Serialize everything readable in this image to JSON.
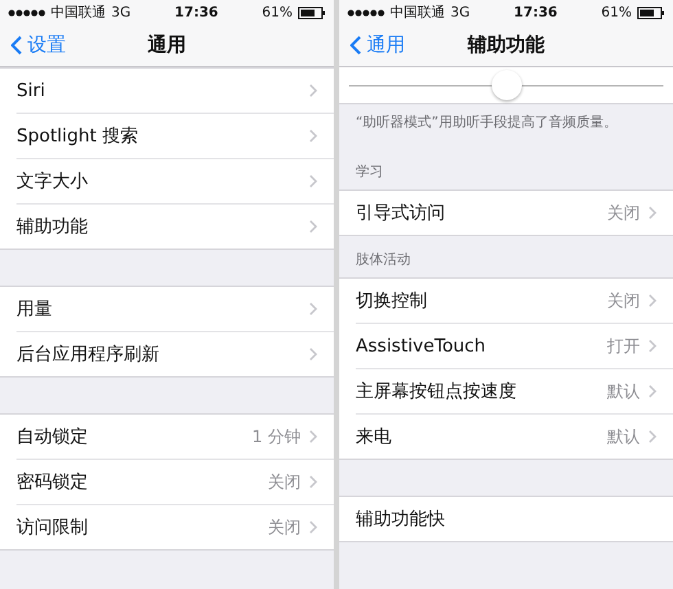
{
  "screens": [
    {
      "status_bar": {
        "carrier": "中国联通",
        "network": "3G",
        "time": "17:36",
        "battery": "61%"
      },
      "nav": {
        "back": "设置",
        "title": "通用"
      },
      "sections": [
        {
          "kind": "group",
          "rows": [
            {
              "label": "Siri",
              "chevron": true
            },
            {
              "label": "Spotlight 搜索",
              "chevron": true
            },
            {
              "label": "文字大小",
              "chevron": true
            },
            {
              "label": "辅助功能",
              "chevron": true
            }
          ]
        },
        {
          "kind": "group",
          "rows": [
            {
              "label": "用量",
              "chevron": true
            },
            {
              "label": "后台应用程序刷新",
              "chevron": true
            }
          ]
        },
        {
          "kind": "group",
          "rows": [
            {
              "label": "自动锁定",
              "value": "1 分钟",
              "chevron": true
            },
            {
              "label": "密码锁定",
              "value": "关闭",
              "chevron": true
            },
            {
              "label": "访问限制",
              "value": "关闭",
              "chevron": true
            }
          ]
        }
      ]
    },
    {
      "status_bar": {
        "carrier": "中国联通",
        "network": "3G",
        "time": "17:36",
        "battery": "61%"
      },
      "nav": {
        "back": "通用",
        "title": "辅助功能"
      },
      "sections": [
        {
          "kind": "slider",
          "level": 0.5
        },
        {
          "kind": "footer",
          "text": "“助听器模式”用助听手段提高了音频质量。"
        },
        {
          "kind": "header",
          "text": "学习"
        },
        {
          "kind": "group",
          "rows": [
            {
              "label": "引导式访问",
              "value": "关闭",
              "chevron": true
            }
          ]
        },
        {
          "kind": "header",
          "text": "肢体活动"
        },
        {
          "kind": "group",
          "rows": [
            {
              "label": "切换控制",
              "value": "关闭",
              "chevron": true
            },
            {
              "label": "AssistiveTouch",
              "value": "打开",
              "chevron": true
            },
            {
              "label": "主屏幕按钮点按速度",
              "value": "默认",
              "chevron": true
            },
            {
              "label": "来电",
              "value": "默认",
              "chevron": true
            }
          ]
        },
        {
          "kind": "group",
          "rows": [
            {
              "label": "辅助功能快",
              "chevron": false
            }
          ]
        }
      ]
    }
  ]
}
